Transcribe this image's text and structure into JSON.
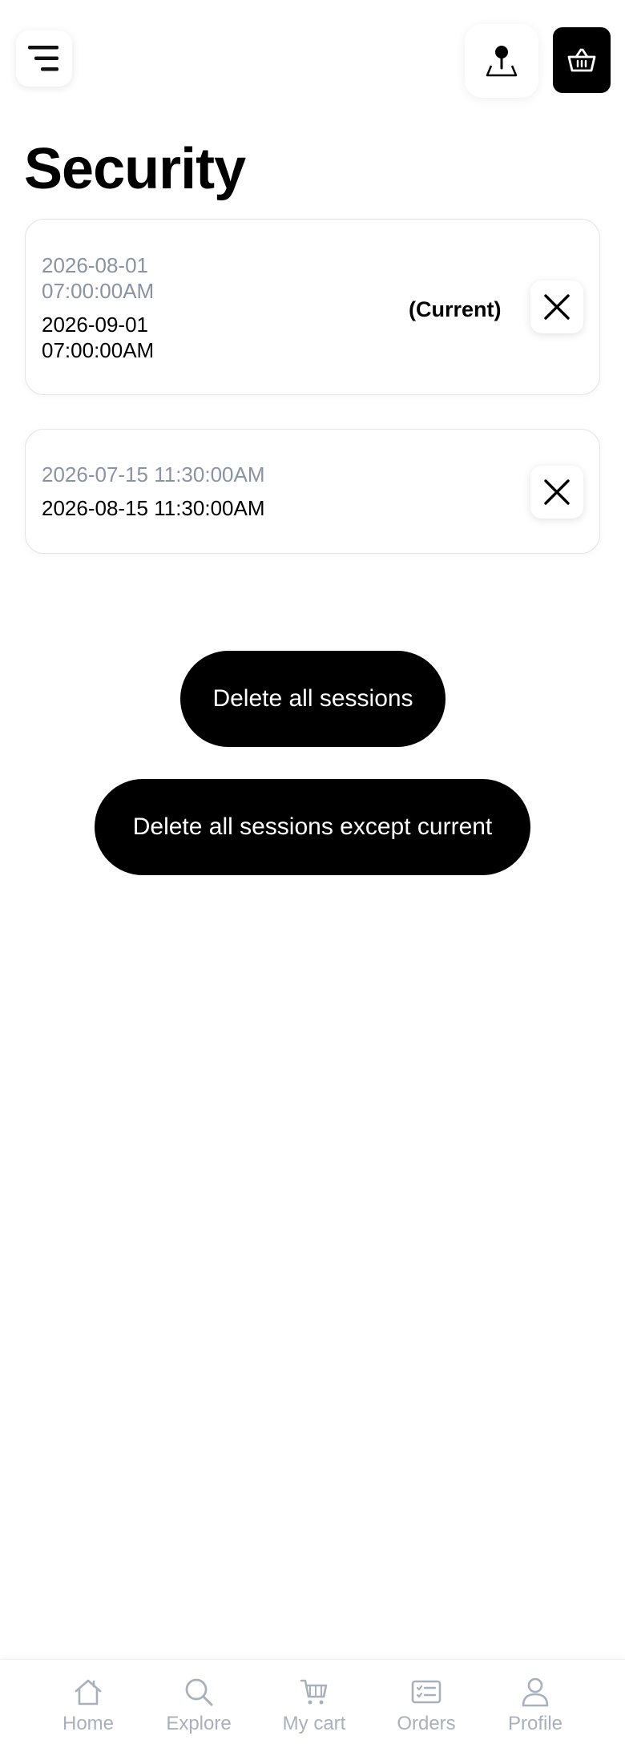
{
  "header": {
    "menu_icon": "menu-icon",
    "location_icon": "location-pin-icon",
    "cart_icon": "basket-icon"
  },
  "page": {
    "title": "Security"
  },
  "sessions": [
    {
      "start": "2026-08-01 07:00:00AM",
      "end": "2026-09-01 07:00:00AM",
      "current_label": "(Current)"
    },
    {
      "start": "2026-07-15 11:30:00AM",
      "end": "2026-08-15 11:30:00AM"
    }
  ],
  "actions": {
    "delete_all": "Delete all sessions",
    "delete_except_current": "Delete all sessions except current"
  },
  "bottom_nav": {
    "items": [
      {
        "label": "Home",
        "icon": "home-icon"
      },
      {
        "label": "Explore",
        "icon": "search-icon"
      },
      {
        "label": "My cart",
        "icon": "cart-icon"
      },
      {
        "label": "Orders",
        "icon": "orders-icon"
      },
      {
        "label": "Profile",
        "icon": "profile-icon"
      }
    ]
  },
  "colors": {
    "accent": "#000000",
    "muted_text": "#8a93a3",
    "nav_inactive": "#a8b0bd",
    "card_border": "#e2e4e8"
  }
}
